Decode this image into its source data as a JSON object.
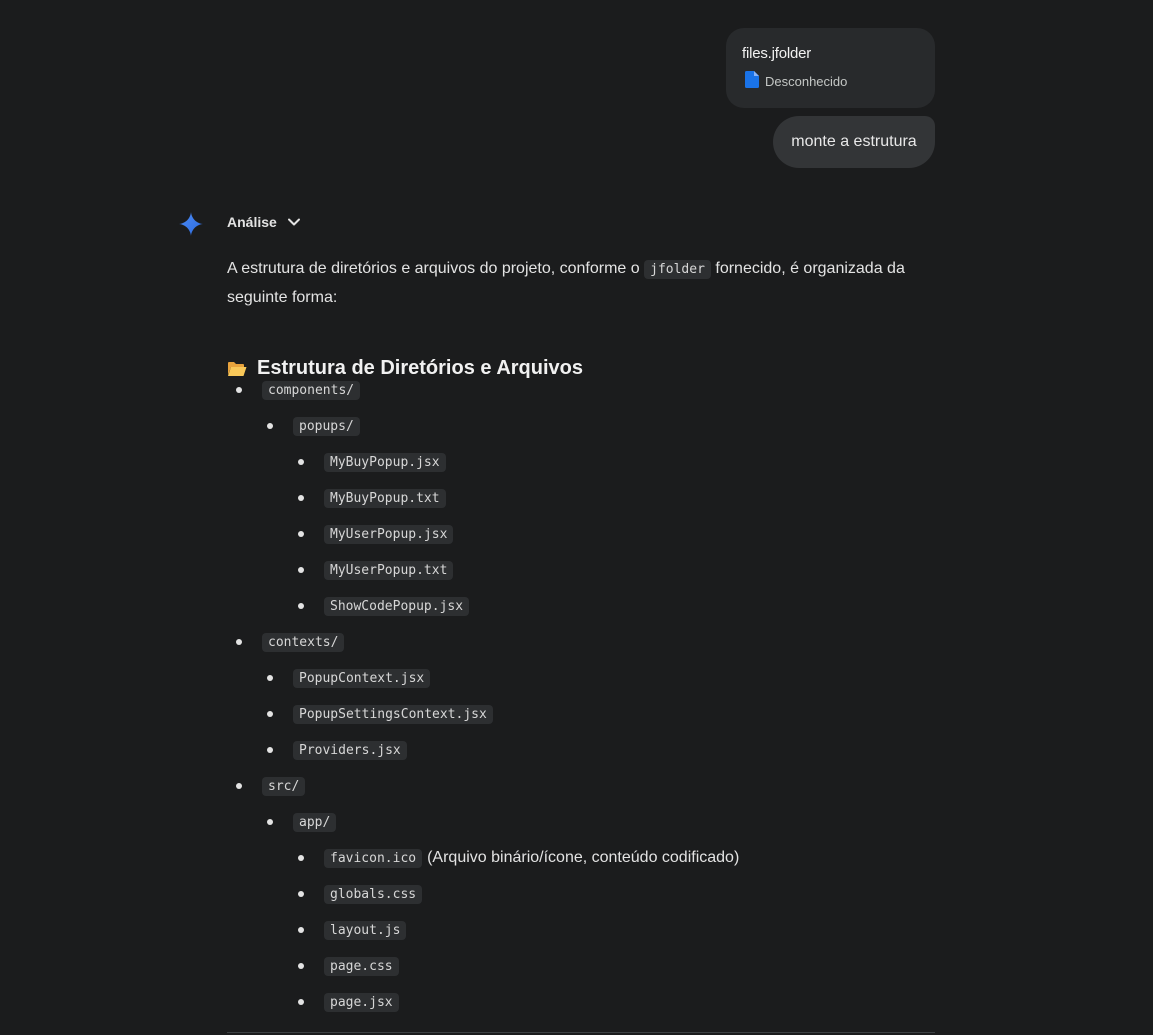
{
  "attachment": {
    "file_name": "files.jfolder",
    "file_type": "Desconhecido",
    "icon": "document-icon"
  },
  "user_message": "monte a estrutura",
  "response": {
    "analysis_label": "Análise",
    "intro_before": "A estrutura de diretórios e arquivos do projeto, conforme o ",
    "intro_code": "jfolder",
    "intro_after": " fornecido, é organizada da seguinte forma:",
    "heading_emoji": "📂",
    "heading": "Estrutura de Diretórios e Arquivos",
    "tree": [
      {
        "name": "components/",
        "level": 0
      },
      {
        "name": "popups/",
        "level": 1
      },
      {
        "name": "MyBuyPopup.jsx",
        "level": 2
      },
      {
        "name": "MyBuyPopup.txt",
        "level": 2
      },
      {
        "name": "MyUserPopup.jsx",
        "level": 2
      },
      {
        "name": "MyUserPopup.txt",
        "level": 2
      },
      {
        "name": "ShowCodePopup.jsx",
        "level": 2
      },
      {
        "name": "contexts/",
        "level": 0
      },
      {
        "name": "PopupContext.jsx",
        "level": 1
      },
      {
        "name": "PopupSettingsContext.jsx",
        "level": 1
      },
      {
        "name": "Providers.jsx",
        "level": 1
      },
      {
        "name": "src/",
        "level": 0
      },
      {
        "name": "app/",
        "level": 1
      },
      {
        "name": "favicon.ico",
        "level": 2,
        "note": "(Arquivo binário/ícone, conteúdo codificado)"
      },
      {
        "name": "globals.css",
        "level": 2
      },
      {
        "name": "layout.js",
        "level": 2
      },
      {
        "name": "page.css",
        "level": 2
      },
      {
        "name": "page.jsx",
        "level": 2
      }
    ]
  }
}
